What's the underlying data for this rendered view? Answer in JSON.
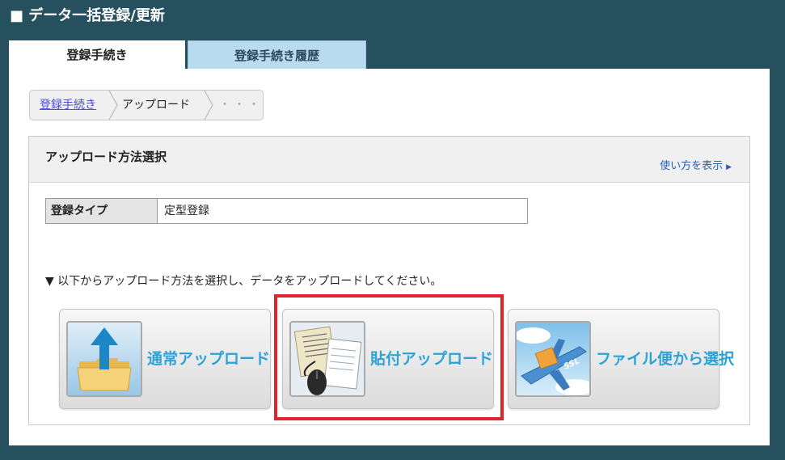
{
  "header": {
    "title": "■ データ一括登録/更新"
  },
  "tabs": [
    {
      "label": "登録手続き",
      "active": true
    },
    {
      "label": "登録手続き履歴",
      "active": false
    }
  ],
  "breadcrumb": {
    "link": "登録手続き",
    "current": "アップロード",
    "ellipsis": "・・・"
  },
  "section": {
    "title": "アップロード方法選択",
    "help_link": "使い方を表示",
    "help_arrow": "▶"
  },
  "type_row": {
    "label": "登録タイプ",
    "value": "定型登録"
  },
  "instruction": "▼ 以下からアップロード方法を選択し、データをアップロードしてください。",
  "buttons": [
    {
      "label": "通常アップロード",
      "icon": "folder-upload-icon"
    },
    {
      "label": "貼付アップロード",
      "icon": "paste-documents-icon",
      "highlighted": true
    },
    {
      "label": "ファイル便から選択",
      "icon": "ssl-airplane-icon"
    }
  ],
  "colors": {
    "background": "#27505f",
    "tab_inactive": "#b9dbee",
    "button_text": "#2ea2d6",
    "highlight": "#e0242b",
    "link": "#4a4adf"
  }
}
